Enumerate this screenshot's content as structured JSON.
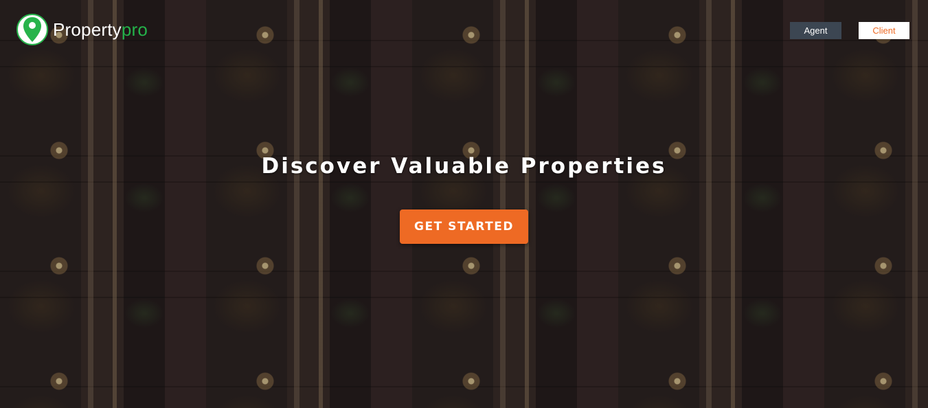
{
  "navbar": {
    "brand_main": "Property",
    "brand_accent": "pro",
    "logo_icon": "map-pin-icon",
    "agent_label": "Agent",
    "client_label": "Client"
  },
  "hero": {
    "title": "Discover Valuable Properties",
    "cta_label": "GET STARTED"
  },
  "colors": {
    "brand_green": "#24b24a",
    "accent_orange": "#ee6a24",
    "agent_button": "#3c4652"
  }
}
